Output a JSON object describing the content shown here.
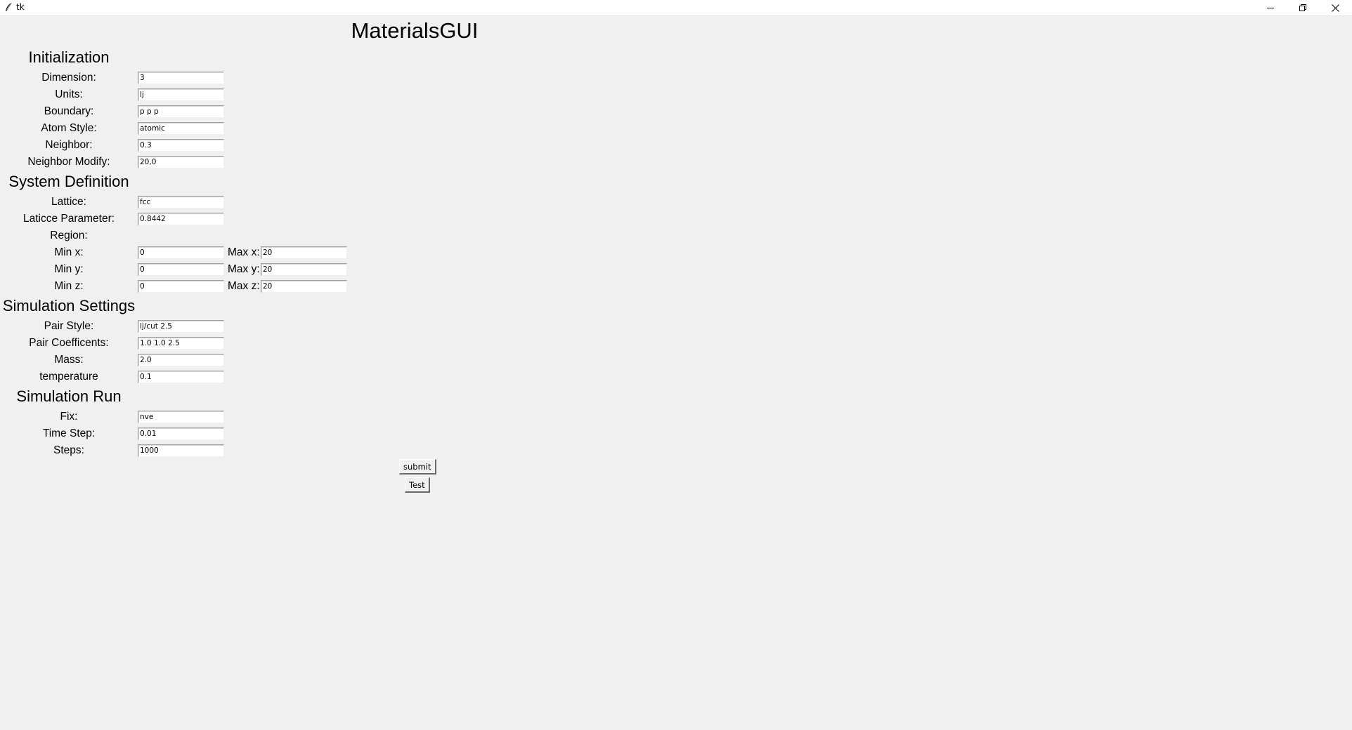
{
  "window": {
    "title": "tk",
    "app_icon": "feather-icon",
    "controls": {
      "minimize_icon": "minimize-icon",
      "maximize_icon": "restore-icon",
      "close_icon": "close-icon"
    }
  },
  "app_title": "MaterialsGUI",
  "sections": {
    "initialization": "Initialization",
    "system_definition": "System Definition",
    "simulation_settings": "Simulation Settings",
    "simulation_run": "Simulation Run"
  },
  "initialization": {
    "dimension": {
      "label": "Dimension:",
      "value": "3"
    },
    "units": {
      "label": "Units:",
      "value": "lj"
    },
    "boundary": {
      "label": "Boundary:",
      "value": "p p p"
    },
    "atom_style": {
      "label": "Atom Style:",
      "value": "atomic"
    },
    "neighbor": {
      "label": "Neighbor:",
      "value": "0.3"
    },
    "neighbor_modify": {
      "label": "Neighbor Modify:",
      "value": "20,0"
    }
  },
  "system_definition": {
    "lattice": {
      "label": "Lattice:",
      "value": "fcc"
    },
    "lattice_parameter": {
      "label": "Laticce Parameter:",
      "value": "0.8442"
    },
    "region": {
      "label": "Region:"
    },
    "min_x": {
      "label": "Min x:",
      "value": "0"
    },
    "max_x": {
      "label": "Max x:",
      "value": "20"
    },
    "min_y": {
      "label": "Min y:",
      "value": "0"
    },
    "max_y": {
      "label": "Max y:",
      "value": "20"
    },
    "min_z": {
      "label": "Min z:",
      "value": "0"
    },
    "max_z": {
      "label": "Max z:",
      "value": "20"
    }
  },
  "simulation_settings": {
    "pair_style": {
      "label": "Pair Style:",
      "value": "lj/cut 2.5"
    },
    "pair_coefficients": {
      "label": "Pair Coefficents:",
      "value": "1.0 1.0 2.5"
    },
    "mass": {
      "label": "Mass:",
      "value": "2.0"
    },
    "temperature": {
      "label": "temperature",
      "value": "0.1"
    }
  },
  "simulation_run": {
    "fix": {
      "label": "Fix:",
      "value": "nve"
    },
    "time_step": {
      "label": "Time Step:",
      "value": "0.01"
    },
    "steps": {
      "label": "Steps:",
      "value": "1000"
    }
  },
  "buttons": {
    "submit": "submit",
    "test": "Test"
  }
}
